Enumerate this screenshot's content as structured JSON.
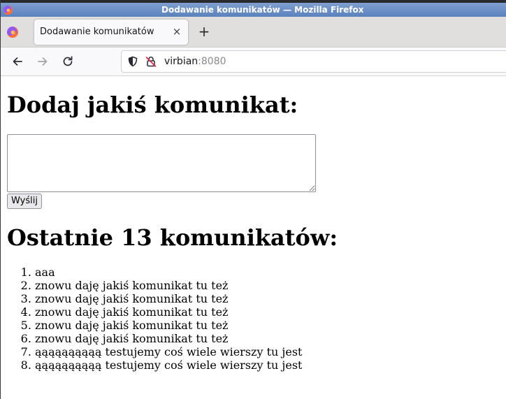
{
  "window": {
    "title": "Dodawanie komunikatów — Mozilla Firefox"
  },
  "tabs": [
    {
      "label": "Dodawanie komunikatów",
      "active": true
    }
  ],
  "toolbar": {
    "new_tab_symbol": "+",
    "close_tab_symbol": "×"
  },
  "url": {
    "host": "virbian",
    "port": ":8080"
  },
  "page": {
    "heading": "Dodaj jakiś komunikat:",
    "textarea_value": "",
    "send_label": "Wyślij",
    "list_heading": "Ostatnie 13 komunikatów:",
    "messages": [
      "aaa",
      "znowu daję jakiś komunikat tu też",
      "znowu daję jakiś komunikat tu też",
      "znowu daję jakiś komunikat tu też",
      "znowu daję jakiś komunikat tu też",
      "znowu daję jakiś komunikat tu też",
      "ąąąąąąąąąą testujemy coś wiele wierszy tu jest",
      "ąąąąąąąąąą testujemy coś wiele wierszy tu jest"
    ]
  },
  "colors": {
    "titlebar": "#6a8dc4",
    "tabstrip": "#e1dfdd",
    "navbar": "#f9f9fb",
    "firefox_orange": "#ff7139",
    "firefox_purple": "#9059ff"
  },
  "icons": {
    "window_menu": "firefox-logo-icon",
    "tabstrip_menu": "firefox-logo-icon",
    "back": "arrow-left-icon",
    "forward": "arrow-right-icon",
    "reload": "reload-icon",
    "tracking": "shield-icon",
    "insecure": "insecure-lock-icon"
  }
}
